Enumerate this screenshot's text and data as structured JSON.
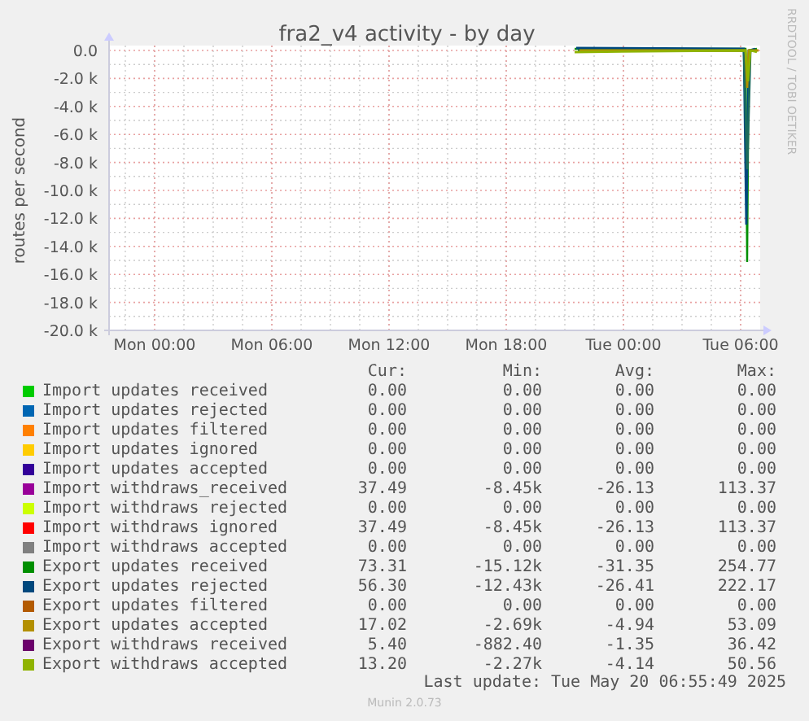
{
  "graph": {
    "title": "fra2_v4 activity - by day",
    "side_label": "RRDTOOL / TOBI OETIKER",
    "ylabel": "routes per second",
    "y_axis_labels": [
      "0.0",
      "-2.0 k",
      "-4.0 k",
      "-6.0 k",
      "-8.0 k",
      "-10.0 k",
      "-12.0 k",
      "-14.0 k",
      "-16.0 k",
      "-18.0 k",
      "-20.0 k"
    ],
    "x_axis_labels": [
      "Mon 00:00",
      "Mon 06:00",
      "Mon 12:00",
      "Mon 18:00",
      "Tue 00:00",
      "Tue 06:00"
    ]
  },
  "legend": {
    "columns": [
      "Cur:",
      "Min:",
      "Avg:",
      "Max:"
    ],
    "rows": [
      {
        "name": "Import updates received",
        "color": "#00cc00",
        "cur": "0.00",
        "min": "0.00",
        "avg": "0.00",
        "max": "0.00"
      },
      {
        "name": "Import updates rejected",
        "color": "#0066b3",
        "cur": "0.00",
        "min": "0.00",
        "avg": "0.00",
        "max": "0.00"
      },
      {
        "name": "Import updates filtered",
        "color": "#ff8000",
        "cur": "0.00",
        "min": "0.00",
        "avg": "0.00",
        "max": "0.00"
      },
      {
        "name": "Import updates ignored",
        "color": "#ffcc00",
        "cur": "0.00",
        "min": "0.00",
        "avg": "0.00",
        "max": "0.00"
      },
      {
        "name": "Import updates accepted",
        "color": "#330099",
        "cur": "0.00",
        "min": "0.00",
        "avg": "0.00",
        "max": "0.00"
      },
      {
        "name": "Import withdraws_received",
        "color": "#990099",
        "cur": "37.49",
        "min": "-8.45k",
        "avg": "-26.13",
        "max": "113.37"
      },
      {
        "name": "Import withdraws rejected",
        "color": "#ccff00",
        "cur": "0.00",
        "min": "0.00",
        "avg": "0.00",
        "max": "0.00"
      },
      {
        "name": "Import withdraws ignored",
        "color": "#ff0000",
        "cur": "37.49",
        "min": "-8.45k",
        "avg": "-26.13",
        "max": "113.37"
      },
      {
        "name": "Import withdraws accepted",
        "color": "#808080",
        "cur": "0.00",
        "min": "0.00",
        "avg": "0.00",
        "max": "0.00"
      },
      {
        "name": "Export updates received",
        "color": "#008f00",
        "cur": "73.31",
        "min": "-15.12k",
        "avg": "-31.35",
        "max": "254.77"
      },
      {
        "name": "Export updates rejected",
        "color": "#00487d",
        "cur": "56.30",
        "min": "-12.43k",
        "avg": "-26.41",
        "max": "222.17"
      },
      {
        "name": "Export updates filtered",
        "color": "#b35a00",
        "cur": "0.00",
        "min": "0.00",
        "avg": "0.00",
        "max": "0.00"
      },
      {
        "name": "Export updates accepted",
        "color": "#b38f00",
        "cur": "17.02",
        "min": "-2.69k",
        "avg": "-4.94",
        "max": "53.09"
      },
      {
        "name": "Export withdraws received",
        "color": "#6b006b",
        "cur": "5.40",
        "min": "-882.40",
        "avg": "-1.35",
        "max": "36.42"
      },
      {
        "name": "Export withdraws accepted",
        "color": "#8fb300",
        "cur": "13.20",
        "min": "-2.27k",
        "avg": "-4.14",
        "max": "50.56"
      }
    ]
  },
  "last_update": "Last update: Tue May 20 06:55:49 2025",
  "footer": "Munin 2.0.73"
}
